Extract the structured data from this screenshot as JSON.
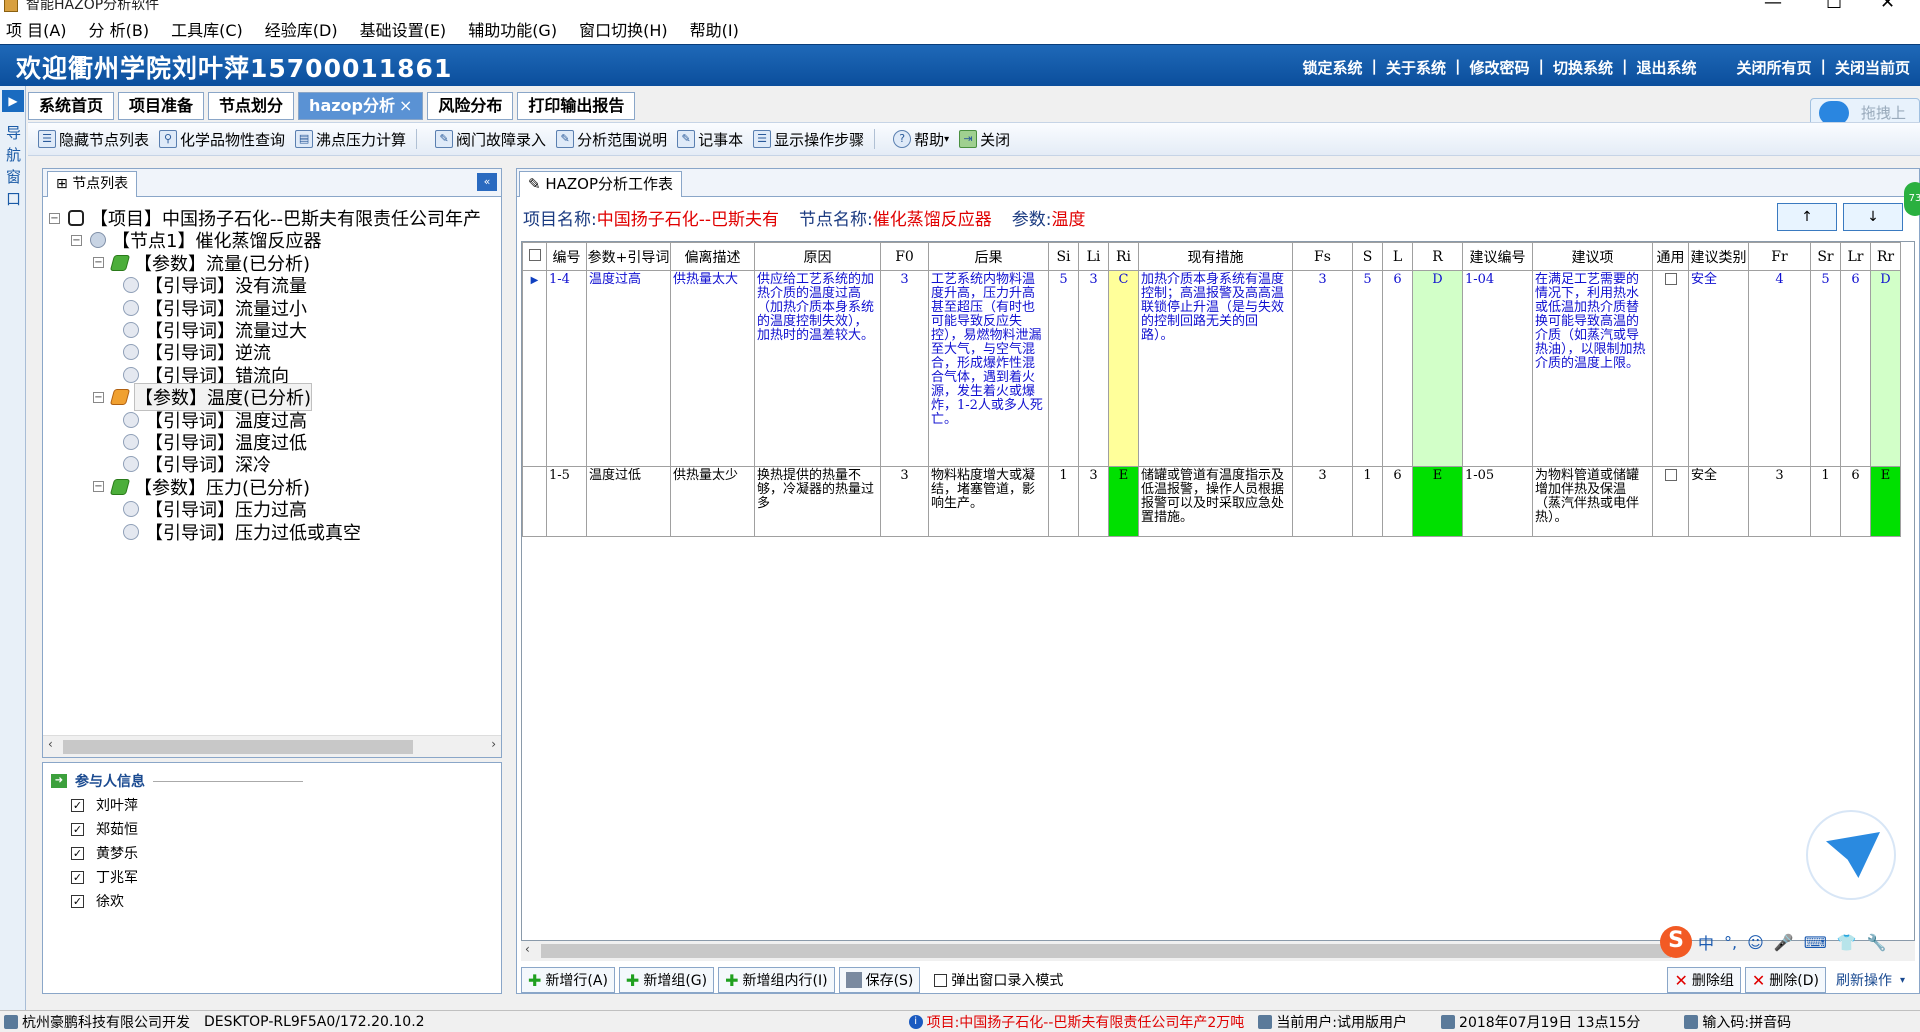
{
  "window": {
    "title": "智能HAZOP分析软件"
  },
  "menu": [
    "项 目(A)",
    "分 析(B)",
    "工具库(C)",
    "经验库(D)",
    "基础设置(E)",
    "辅助功能(G)",
    "窗口切换(H)",
    "帮助(I)"
  ],
  "banner": {
    "welcome": "欢迎衢州学院刘叶萍15700011861",
    "links": [
      "锁定系统",
      "关于系统",
      "修改密码",
      "切换系统",
      "退出系统"
    ],
    "links_right": [
      "关闭所有页",
      "关闭当前页"
    ]
  },
  "leftstrip": {
    "label": "导航窗口"
  },
  "tabs": [
    "系统首页",
    "项目准备",
    "节点划分",
    "hazop分析",
    "风险分布",
    "打印输出报告"
  ],
  "toolbar": [
    "隐藏节点列表",
    "化学品物性查询",
    "沸点压力计算",
    "阀门故障录入",
    "分析范围说明",
    "记事本",
    "显示操作步骤",
    "帮助",
    "关闭"
  ],
  "upload": "拖拽上传",
  "node_panel": {
    "tab": "节点列表",
    "tree": [
      {
        "level": 0,
        "type": "proj",
        "text": "【项目】中国扬子石化--巴斯夫有限责任公司年产",
        "exp": "−"
      },
      {
        "level": 1,
        "type": "node",
        "text": "【节点1】催化蒸馏反应器",
        "exp": "−"
      },
      {
        "level": 2,
        "type": "param",
        "text": "【参数】流量(已分析)",
        "exp": "−"
      },
      {
        "level": 3,
        "type": "guide",
        "text": "【引导词】没有流量"
      },
      {
        "level": 3,
        "type": "guide",
        "text": "【引导词】流量过小"
      },
      {
        "level": 3,
        "type": "guide",
        "text": "【引导词】流量过大"
      },
      {
        "level": 3,
        "type": "guide",
        "text": "【引导词】逆流"
      },
      {
        "level": 3,
        "type": "guide",
        "text": "【引导词】错流向"
      },
      {
        "level": 2,
        "type": "param2",
        "text": "【参数】温度(已分析)",
        "exp": "−"
      },
      {
        "level": 3,
        "type": "guide",
        "text": "【引导词】温度过高"
      },
      {
        "level": 3,
        "type": "guide",
        "text": "【引导词】温度过低"
      },
      {
        "level": 3,
        "type": "guide",
        "text": "【引导词】深冷"
      },
      {
        "level": 2,
        "type": "param",
        "text": "【参数】压力(已分析)",
        "exp": "−"
      },
      {
        "level": 3,
        "type": "guide",
        "text": "【引导词】压力过高"
      },
      {
        "level": 3,
        "type": "guide",
        "text": "【引导词】压力过低或真空"
      }
    ]
  },
  "participants": {
    "title": "参与人信息",
    "people": [
      "刘叶萍",
      "郑茹恒",
      "黄梦乐",
      "丁兆军",
      "徐欢"
    ]
  },
  "workpanel": {
    "tab": "HAZOP分析工作表",
    "project_label": "项目名称:",
    "project_value": "中国扬子石化--巴斯夫有",
    "node_label": "节点名称:",
    "node_value": "催化蒸馏反应器",
    "param_label": "参数:",
    "param_value": "温度",
    "up": "↑",
    "down": "↓"
  },
  "grid": {
    "columns": [
      "编号",
      "参数+引导词",
      "偏离描述",
      "原因",
      "F0",
      "后果",
      "Si",
      "Li",
      "Ri",
      "现有措施",
      "Fs",
      "S",
      "L",
      "R",
      "建议编号",
      "建议项",
      "通用",
      "建议类别",
      "Fr",
      "Sr",
      "Lr",
      "Rr"
    ],
    "rows": [
      {
        "id": "1-4",
        "param": "温度过高",
        "dev": "供热量太大",
        "cause": "供应给工艺系统的加热介质的温度过高（加热介质本身系统的温度控制失效），加热时的温差较大。",
        "f0": "3",
        "conseq": "工艺系统内物料温度升高，压力升高甚至超压（有时也可能导致反应失控），易燃物料泄漏至大气，与空气混合，形成爆炸性混合气体，遇到着火源，发生着火或爆炸，1-2人或多人死亡。",
        "si": "5",
        "li": "3",
        "ri": "C",
        "measure": "加热介质本身系统有温度控制；高温报警及高高温联锁停止升温（是与失效的控制回路无关的回路）。",
        "fs": "3",
        "s": "5",
        "l": "6",
        "r": "D",
        "sugid": "1-04",
        "sug": "在满足工艺需要的情况下，利用热水或低温加热介质替换可能导致高温的介质（如蒸汽或导热油），以限制加热介质的温度上限。",
        "cat": "安全",
        "fr": "4",
        "sr": "5",
        "lr": "6",
        "rr": "D"
      },
      {
        "id": "1-5",
        "param": "温度过低",
        "dev": "供热量太少",
        "cause": "换热提供的热量不够，冷凝器的热量过多",
        "f0": "3",
        "conseq": "物料粘度增大或凝结，堵塞管道，影响生产。",
        "si": "1",
        "li": "3",
        "ri": "E",
        "measure": "储罐或管道有温度指示及低温报警，操作人员根据报警可以及时采取应急处置措施。",
        "fs": "3",
        "s": "1",
        "l": "6",
        "r": "E",
        "sugid": "1-05",
        "sug": "为物料管道或储罐增加伴热及保温（蒸汽伴热或电伴热）。",
        "cat": "安全",
        "fr": "3",
        "sr": "1",
        "lr": "6",
        "rr": "E"
      }
    ]
  },
  "bottom_buttons": [
    "新增行(A)",
    "新增组(G)",
    "新增组内行(I)",
    "保存(S)"
  ],
  "popup_check": "弹出窗口录入模式",
  "right_buttons": [
    "删除组",
    "删除(D)",
    "刷新操作"
  ],
  "status": {
    "company": "杭州豪鹏科技有限公司开发",
    "host": "DESKTOP-RL9F5A0/172.20.10.2",
    "project": "项目:中国扬子石化--巴斯夫有限责任公司年产2万吨",
    "user": "当前用户:试用版用户",
    "date": "2018年07月19日 13点15分",
    "ime": "输入码:拼音码"
  },
  "ime_bar": {
    "items": [
      "中",
      "°,",
      "☺",
      "🎤",
      "⌨",
      "👕",
      "🔧"
    ]
  },
  "badge": "73"
}
